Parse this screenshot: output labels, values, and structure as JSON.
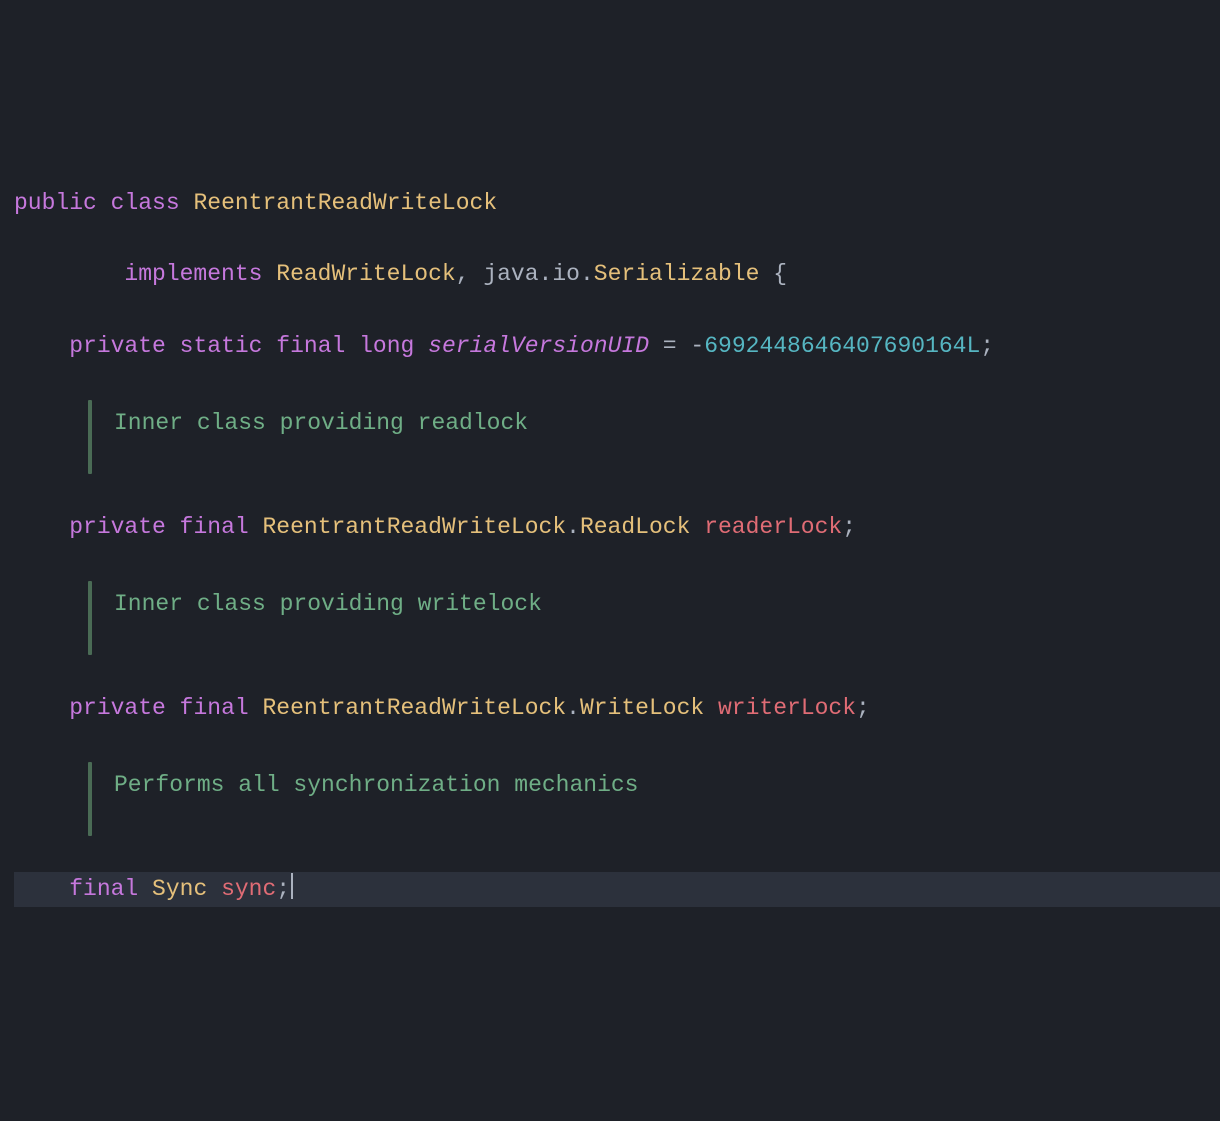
{
  "code": {
    "line1": {
      "public": "public",
      "class_kw": "class",
      "classname": "ReentrantReadWriteLock"
    },
    "line2": {
      "implements": "implements",
      "iface1": "ReadWriteLock",
      "comma": ",",
      "pkg": "java",
      "dot1": ".",
      "io": "io",
      "dot2": ".",
      "iface2": "Serializable",
      "brace": " {"
    },
    "line3": {
      "private": "private",
      "static": "static",
      "final": "final",
      "long": "long",
      "field": "serialVersionUID",
      "eq": " = ",
      "minus": "-",
      "num": "6992448646407690164L",
      "semi": ";"
    },
    "doc1": "Inner class providing readlock",
    "line4": {
      "private": "private",
      "final": "final",
      "type1": "ReentrantReadWriteLock",
      "dot": ".",
      "type2": "ReadLock",
      "field": "readerLock",
      "semi": ";"
    },
    "doc2": "Inner class providing writelock",
    "line5": {
      "private": "private",
      "final": "final",
      "type1": "ReentrantReadWriteLock",
      "dot": ".",
      "type2": "WriteLock",
      "field": "writerLock",
      "semi": ";"
    },
    "doc3": "Performs all synchronization mechanics",
    "line6": {
      "final": "final",
      "type": "Sync",
      "field": "sync",
      "semi": ";"
    }
  }
}
